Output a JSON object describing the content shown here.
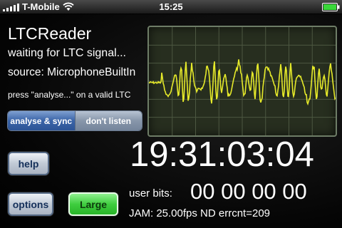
{
  "status_bar": {
    "carrier": "T-Mobile",
    "time": "15:25",
    "signal_bars": 5,
    "battery_level": 1.0,
    "battery_color": "#3ad83a"
  },
  "app": {
    "title": "LTCReader",
    "status": "waiting for LTC signal...",
    "source": "source: MicrophoneBuiltIn",
    "hint": "press \"analyse...\" on a valid LTC",
    "segmented": {
      "active_label": "analyse & sync",
      "idle_label": "don't listen"
    },
    "buttons": {
      "help": "help",
      "options": "options",
      "large": "Large"
    },
    "timecode": "19:31:03:04",
    "user_bits_label": "user bits:",
    "user_bits_value": "00 00 00 00",
    "jam_info": "JAM: 25.00fps ND errcnt=209"
  },
  "colors": {
    "waveform": "#e6ea2a",
    "scope_grid": "#4c5741",
    "scope_bg": "#272e1f",
    "segment_active": "#3a64a8"
  }
}
